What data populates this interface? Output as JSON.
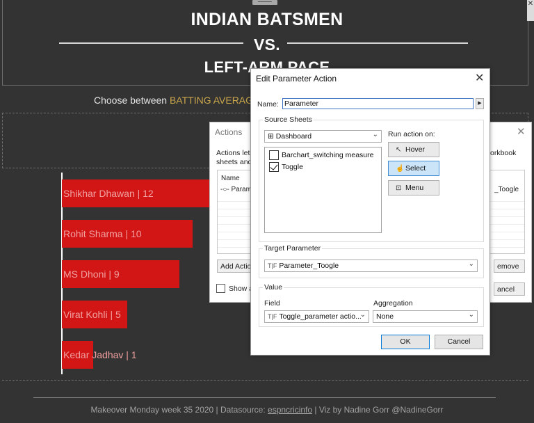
{
  "dashboard": {
    "title_line1": "INDIAN BATSMEN",
    "title_line2": "VS.",
    "title_line3": "LEFT-ARM PACE",
    "subtitle_prefix": "Choose between ",
    "subtitle_highlight": "BATTING AVERAGES",
    "bars": [
      {
        "label": "Shikhar Dhawan | 12",
        "value": 12
      },
      {
        "label": "Rohit Sharma | 10",
        "value": 10
      },
      {
        "label": "MS Dhoni | 9",
        "value": 9
      },
      {
        "label": "Virat Kohli | 5",
        "value": 5
      },
      {
        "label": "Kedar Jadhav | 1",
        "value": 1
      }
    ],
    "footer_part1": "Makeover Monday week 35 2020 | Datasource: ",
    "footer_link": "espncricinfo",
    "footer_part2": "  | Viz by Nadine Gorr @NadineGorr",
    "colors": {
      "bar": "#d21515",
      "highlight": "#c9a64a",
      "background": "#333333"
    }
  },
  "actions_dialog": {
    "title": "Actions",
    "desc_line1": "Actions let",
    "desc_line2": "sheets and",
    "desc_right": "orkbook",
    "list_header": "Name",
    "list_row": "Param",
    "list_row_right": "_Toogle",
    "add_action_label": "Add Actio",
    "remove_label": "emove",
    "show_label": "Show a",
    "cancel_label": "ancel"
  },
  "edit_param_dialog": {
    "title": "Edit Parameter Action",
    "name_label": "Name:",
    "name_value": "Parameter",
    "source_sheets_label": "Source Sheets",
    "dashboard_select": "Dashboard",
    "sheets": [
      {
        "name": "Barchart_switching measure",
        "checked": false
      },
      {
        "name": "Toggle",
        "checked": true
      }
    ],
    "run_action_label": "Run action on:",
    "run_options": [
      {
        "label": "Hover",
        "icon": "pointer-icon",
        "selected": false
      },
      {
        "label": "Select",
        "icon": "hand-pointer-icon",
        "selected": true
      },
      {
        "label": "Menu",
        "icon": "menu-pointer-icon",
        "selected": false
      }
    ],
    "target_parameter_label": "Target Parameter",
    "tf_prefix": "T|F",
    "target_parameter_value": "Parameter_Toogle",
    "value_label": "Value",
    "field_label": "Field",
    "field_value": "Toggle_parameter actio...",
    "aggregation_label": "Aggregation",
    "aggregation_value": "None",
    "ok_label": "OK",
    "cancel_label": "Cancel"
  }
}
